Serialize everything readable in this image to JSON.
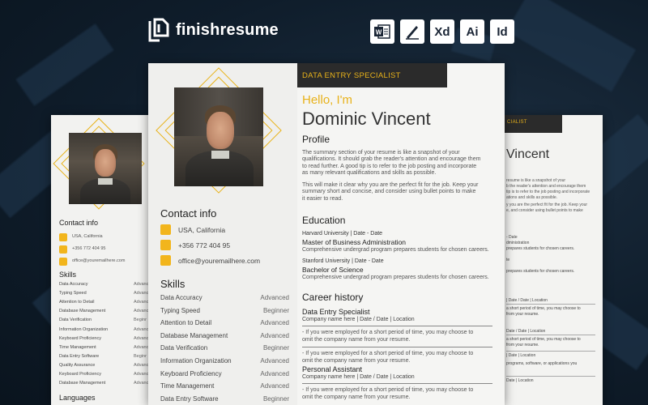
{
  "brand": {
    "name": "finishresume"
  },
  "apps": [
    "W",
    "",
    "Xd",
    "Ai",
    "Id"
  ],
  "app_icons": [
    "word-icon",
    "pen-icon",
    "xd-icon",
    "ai-icon",
    "id-icon"
  ],
  "resume": {
    "banner": "DATA ENTRY SPECIALIST",
    "hello": "Hello, I'm",
    "name": "Dominic Vincent",
    "profile_heading": "Profile",
    "profile_p1": [
      "The summary section of your resume is like a snapshot of your",
      "qualifications. It should grab the reader's attention and encourage them",
      "to read further. A good tip is to refer to the job posting and incorporate",
      "as many relevant qualifications and skills as possible."
    ],
    "profile_p2": [
      "This will make it clear why you are the perfect fit for the job. Keep your",
      "summary short and concise, and consider using bullet points to make",
      "it easier to read."
    ],
    "education_heading": "Education",
    "education": [
      {
        "school": "Harvard University | Date - Date",
        "degree": "Master of Business Administration",
        "desc": "Comprehensive undergrad program prepares students for chosen careers."
      },
      {
        "school": "Stanford University | Date - Date",
        "degree": "Bachelor of Science",
        "desc": "Comprehensive undergrad program prepares students for chosen careers."
      }
    ],
    "career_heading": "Career history",
    "career": [
      {
        "title": "Data Entry Specialist",
        "company": "Company name here | Date / Date | Location",
        "desc": [
          "- If you were employed for a short period of time, you may choose to",
          "omit the company name from your resume."
        ],
        "desc2": [
          "- If you were employed for a short period of time, you may choose to",
          "omit the company name from your resume."
        ]
      },
      {
        "title": "Personal Assistant",
        "company": "Company name here | Date / Date | Location",
        "desc": [
          "- If you were employed for a short period of time, you may choose to",
          "omit the company name from your resume."
        ]
      }
    ],
    "contact_heading": "Contact info",
    "contact": [
      "USA, California",
      "+356 772 404 95",
      "office@youremailhere.com"
    ],
    "skills_heading": "Skills",
    "skills_main": [
      {
        "name": "Data Accuracy",
        "level": "Advanced"
      },
      {
        "name": "Typing Speed",
        "level": "Beginner"
      },
      {
        "name": "Attention to Detail",
        "level": "Advanced"
      },
      {
        "name": "Database Management",
        "level": "Advanced"
      },
      {
        "name": "Data Verification",
        "level": "Beginner"
      },
      {
        "name": "Information Organization",
        "level": "Advanced"
      },
      {
        "name": "Keyboard Proficiency",
        "level": "Advanced"
      },
      {
        "name": "Time Management",
        "level": "Advanced"
      },
      {
        "name": "Data Entry Software",
        "level": "Beginner"
      }
    ],
    "skills_left": [
      {
        "name": "Data Accuracy",
        "level": "Advanc"
      },
      {
        "name": "Typing Speed",
        "level": "Advanc"
      },
      {
        "name": "Attention to Detail",
        "level": "Advanc"
      },
      {
        "name": "Database Management",
        "level": "Advanc"
      },
      {
        "name": "Data Verification",
        "level": "Beginr"
      },
      {
        "name": "Information Organization",
        "level": "Advanc"
      },
      {
        "name": "Keyboard Proficiency",
        "level": "Advanc"
      },
      {
        "name": "Time Management",
        "level": "Advanc"
      },
      {
        "name": "Data Entry Software",
        "level": "Beginr"
      },
      {
        "name": "Quality Assurance",
        "level": "Advanc"
      },
      {
        "name": "Keyboard Proficiency",
        "level": "Advanc"
      },
      {
        "name": "Database Management",
        "level": "Advanc"
      }
    ],
    "languages_heading": "Languages"
  },
  "right_sheet": {
    "banner": "CIALIST",
    "name": "Vincent",
    "lines": [
      "resume is like a snapshot of your",
      "b the reader's attention and encourage them",
      "tip is to refer to the job posting and incorporate",
      "ations and skills as possible.",
      "y you are the perfect fit for the job. Keep your",
      "e, and consider using bullet points to make"
    ],
    "edu": [
      "- Date",
      "dministration",
      "prepares students for chosen careers.",
      "te",
      "prepares students for chosen careers."
    ],
    "career": [
      "| Date / Date | Location",
      "a short period of time, you may choose to",
      "from your resume.",
      "Date / Date | Location",
      "a short period of time, you may choose to",
      "from your resume.",
      "| Date | Location",
      "programs, software, or applications you",
      "Date | Location"
    ]
  }
}
